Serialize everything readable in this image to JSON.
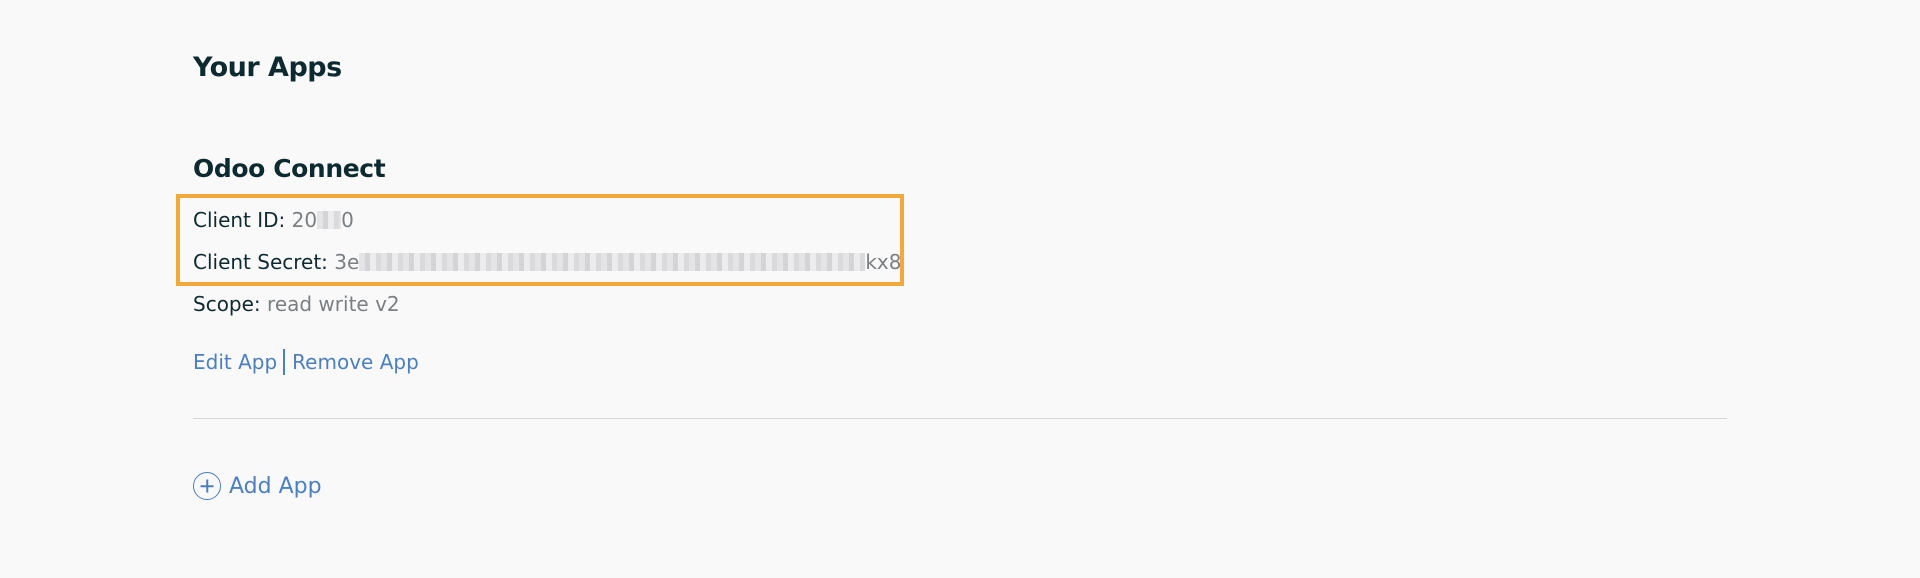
{
  "page": {
    "title": "Your Apps"
  },
  "app": {
    "name": "Odoo Connect",
    "client_id": {
      "label": "Client ID:",
      "value_start": "20",
      "value_end": "0"
    },
    "client_secret": {
      "label": "Client Secret:",
      "value_start": "3e",
      "value_end": "kx8"
    },
    "scope": {
      "label": "Scope:",
      "value": "read write v2"
    },
    "actions": {
      "edit_label": "Edit App",
      "remove_label": "Remove App"
    }
  },
  "add_app": {
    "label": "Add App",
    "icon": "plus-circle-icon"
  },
  "colors": {
    "highlight": "#f0a93a",
    "link": "#4c7fbe",
    "heading": "#0d2a30",
    "muted": "#7b7f82",
    "background": "#f9f9fa"
  }
}
